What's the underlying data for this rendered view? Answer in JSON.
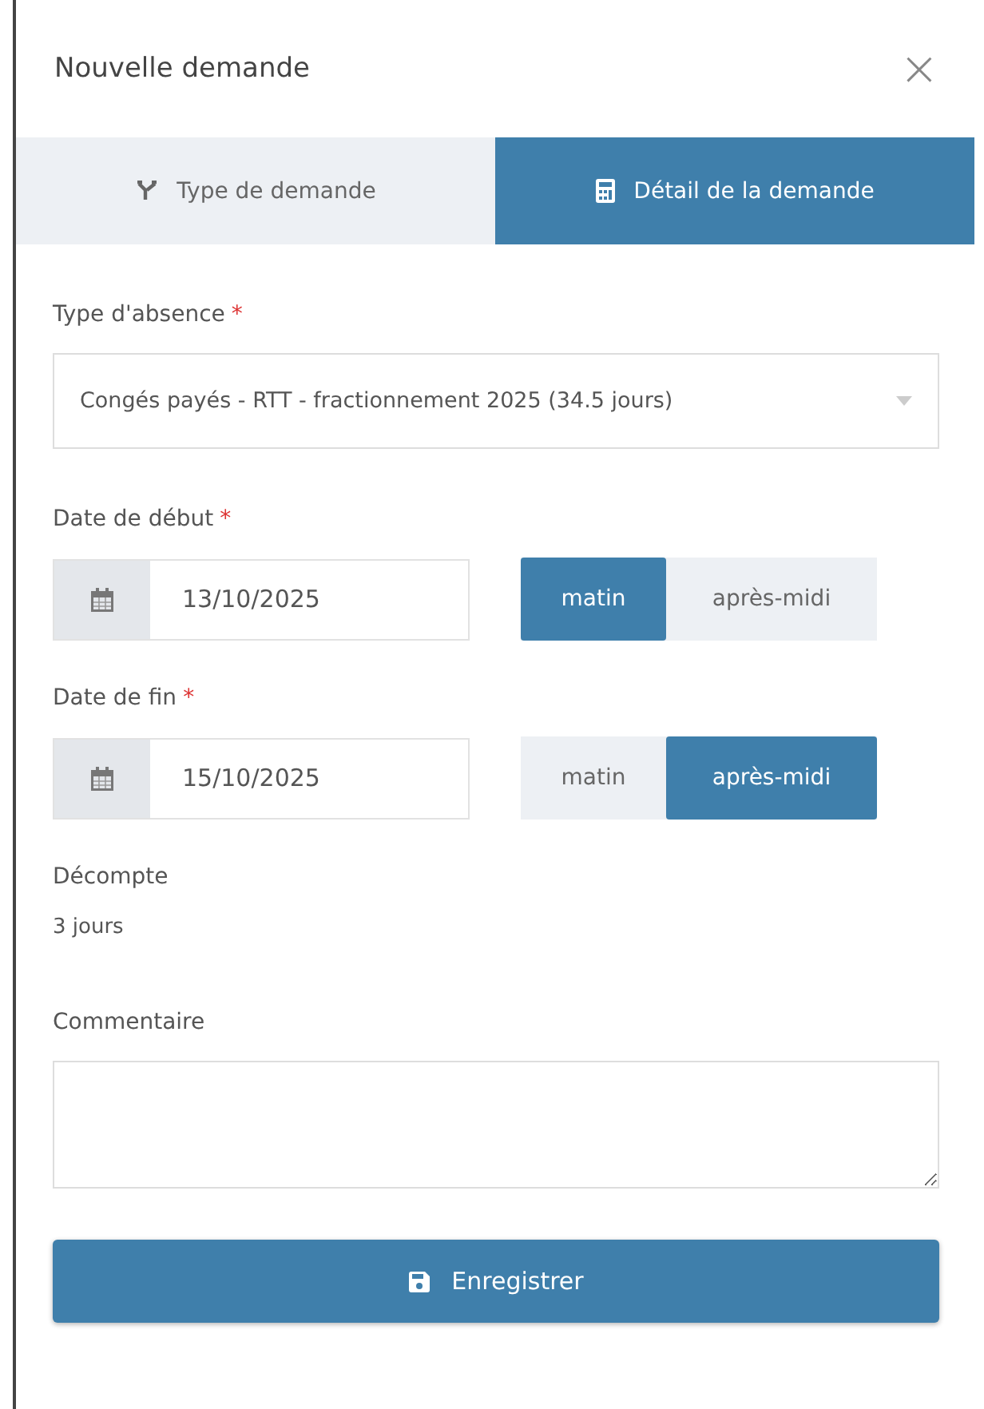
{
  "dialog": {
    "title": "Nouvelle demande",
    "close": "×"
  },
  "tabs": [
    {
      "label": "Type de demande",
      "selected": false
    },
    {
      "label": "Détail de la demande",
      "selected": true
    }
  ],
  "absence_type": {
    "label": "Type d'absence",
    "required_mark": "*",
    "value": "Congés payés - RTT - fractionnement 2025 (34.5 jours)"
  },
  "dates": [
    {
      "label": "Date de début",
      "required_mark": "*",
      "value": "13/10/2025",
      "periods": [
        {
          "label": "matin",
          "selected": true
        },
        {
          "label": "après-midi",
          "selected": false
        }
      ]
    },
    {
      "label": "Date de fin",
      "required_mark": "*",
      "value": "15/10/2025",
      "periods": [
        {
          "label": "matin",
          "selected": false
        },
        {
          "label": "après-midi",
          "selected": true
        }
      ]
    }
  ],
  "count": {
    "label": "Décompte",
    "value": "3 jours"
  },
  "comment": {
    "label": "Commentaire"
  },
  "save_button": "Enregistrer"
}
